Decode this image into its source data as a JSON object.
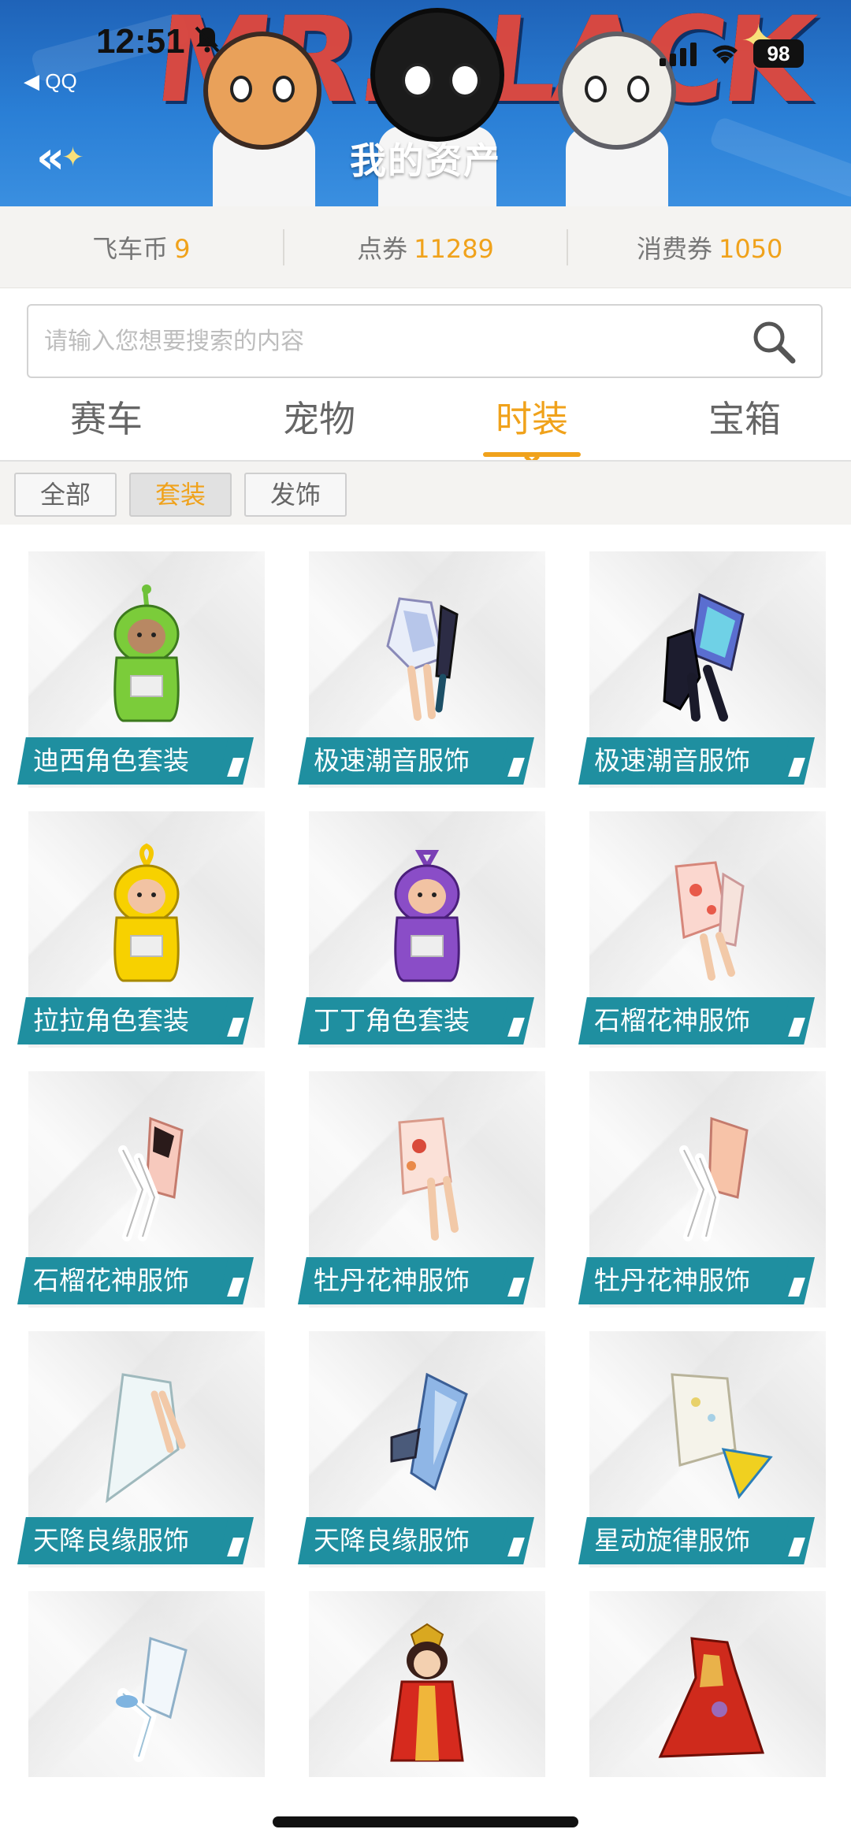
{
  "status_bar": {
    "time": "12:51",
    "back_app": "◀ QQ",
    "battery": "98"
  },
  "header": {
    "banner_text": "MR.BLACK",
    "title": "我的资产",
    "back_icon": "double-chevron-left-icon"
  },
  "currency": [
    {
      "label": "飞车币",
      "value": "9"
    },
    {
      "label": "点券",
      "value": "11289"
    },
    {
      "label": "消费券",
      "value": "1050"
    }
  ],
  "search": {
    "placeholder": "请输入您想要搜索的内容",
    "value": ""
  },
  "tabs": [
    {
      "label": "赛车",
      "active": false
    },
    {
      "label": "宠物",
      "active": false
    },
    {
      "label": "时装",
      "active": true
    },
    {
      "label": "宝箱",
      "active": false
    }
  ],
  "filters": [
    {
      "label": "全部",
      "active": false
    },
    {
      "label": "套装",
      "active": true
    },
    {
      "label": "发饰",
      "active": false
    }
  ],
  "items": [
    {
      "label": "迪西角色套装",
      "art": "green-teletubby"
    },
    {
      "label": "极速潮音服饰",
      "art": "white-purple-outfit"
    },
    {
      "label": "极速潮音服饰",
      "art": "black-blue-outfit"
    },
    {
      "label": "拉拉角色套装",
      "art": "yellow-teletubby"
    },
    {
      "label": "丁丁角色套装",
      "art": "purple-teletubby"
    },
    {
      "label": "石榴花神服饰",
      "art": "pink-floral-outfit"
    },
    {
      "label": "石榴花神服饰",
      "art": "pink-white-outfit"
    },
    {
      "label": "牡丹花神服饰",
      "art": "peach-floral-outfit"
    },
    {
      "label": "牡丹花神服饰",
      "art": "peach-white-outfit"
    },
    {
      "label": "天降良缘服饰",
      "art": "white-veil-outfit"
    },
    {
      "label": "天降良缘服饰",
      "art": "blue-robe-outfit"
    },
    {
      "label": "星动旋律服饰",
      "art": "white-gold-outfit"
    },
    {
      "label": "",
      "art": "white-blue-outfit"
    },
    {
      "label": "",
      "art": "red-empress-figure"
    },
    {
      "label": "",
      "art": "red-dress-outfit"
    }
  ],
  "colors": {
    "accent": "#f0a21b",
    "label_bg": "#1f8fa0",
    "header_blue": "#2a7fd6"
  }
}
